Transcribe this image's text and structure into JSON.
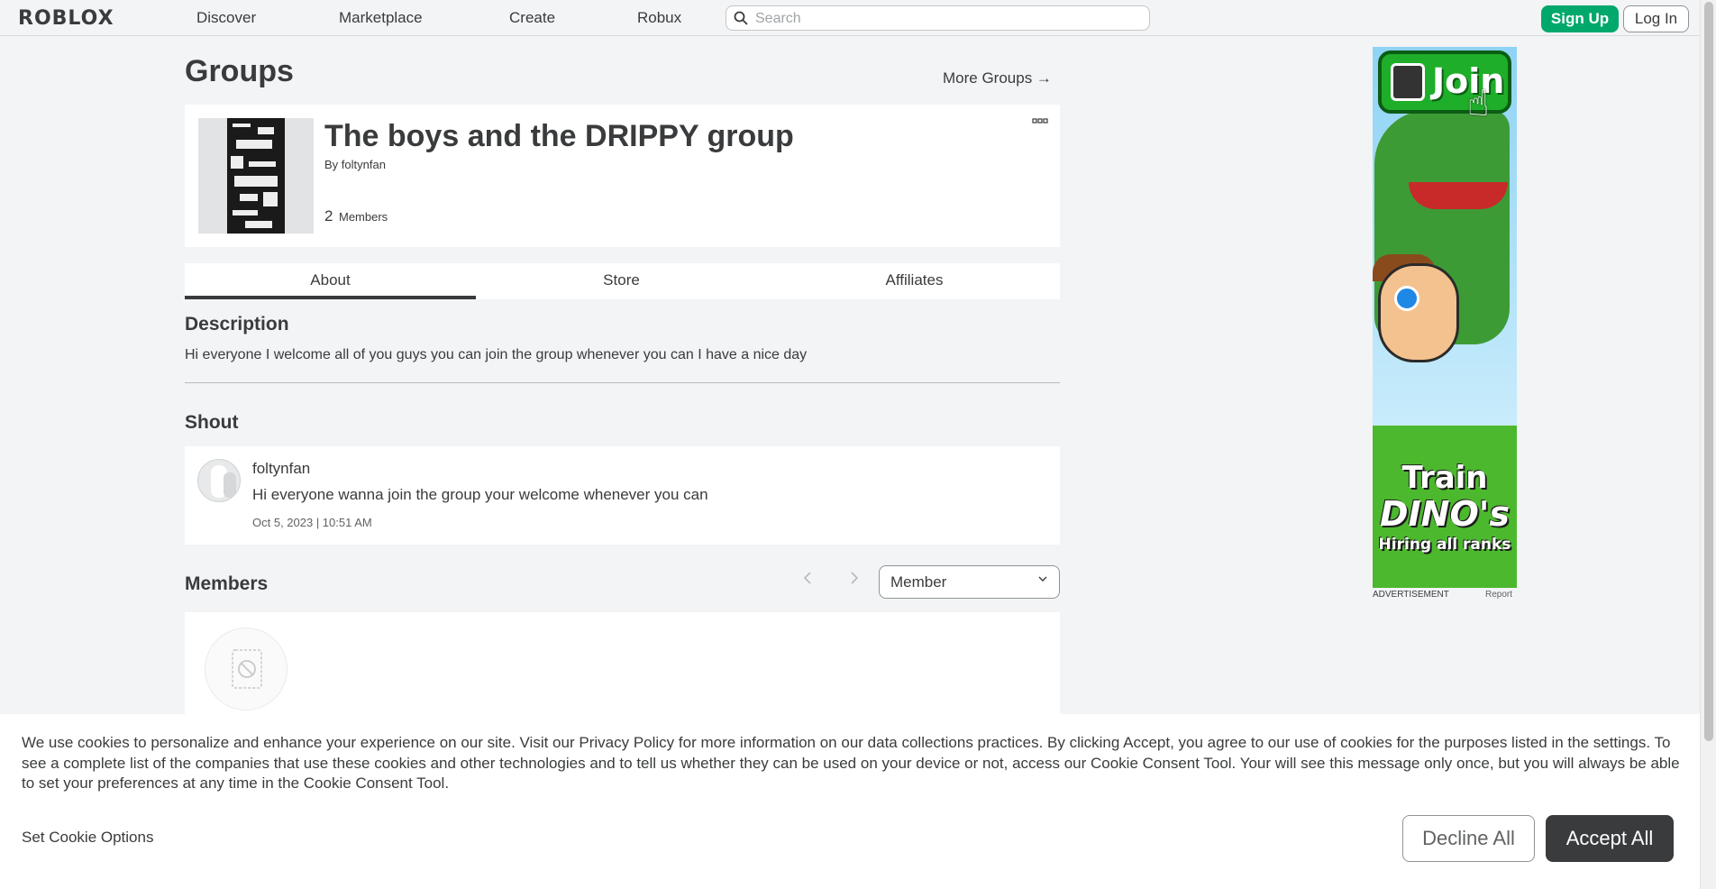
{
  "header": {
    "logo": "ROBLOX",
    "nav": [
      "Discover",
      "Marketplace",
      "Create",
      "Robux"
    ],
    "search_placeholder": "Search",
    "signup": "Sign Up",
    "login": "Log In"
  },
  "page": {
    "title": "Groups",
    "more_groups": "More Groups →"
  },
  "group": {
    "name": "The boys and the DRIPPY group",
    "by_prefix": "By",
    "owner": "foltynfan",
    "member_count": "2",
    "members_label": "Members",
    "more_icon": "ellipsis-icon"
  },
  "tabs": [
    "About",
    "Store",
    "Affiliates"
  ],
  "about": {
    "description_title": "Description",
    "description": "Hi everyone I welcome all of you guys you can join the group whenever you can I have a nice day",
    "shout_title": "Shout",
    "shout": {
      "user": "foltynfan",
      "text": "Hi everyone wanna join the group your welcome whenever you can",
      "date": "Oct 5, 2023 | 10:51 AM"
    },
    "members_title": "Members",
    "role_selected": "Member"
  },
  "ad": {
    "join": "Join",
    "line1": "Train",
    "line2": "DINO's",
    "line3": "Hiring all ranks",
    "label": "ADVERTISEMENT",
    "report": "Report"
  },
  "cookie": {
    "text_before": "We use cookies to personalize and enhance your experience on our site. Visit our ",
    "privacy_link": "Privacy Policy",
    "text_after": " for more information on our data collections practices. By clicking Accept, you agree to our use of cookies for the purposes listed in the settings. To see a complete list of the companies that use these cookies and other technologies and to tell us whether they can be used on your device or not, access our Cookie Consent Tool. Your will see this message only once, but you will always be able to set your preferences at any time in the Cookie Consent Tool.",
    "set_options": "Set Cookie Options",
    "decline": "Decline All",
    "accept": "Accept All"
  },
  "colors": {
    "accent_green": "#00a86b",
    "text": "#393b3d",
    "background": "#f2f4f5"
  }
}
